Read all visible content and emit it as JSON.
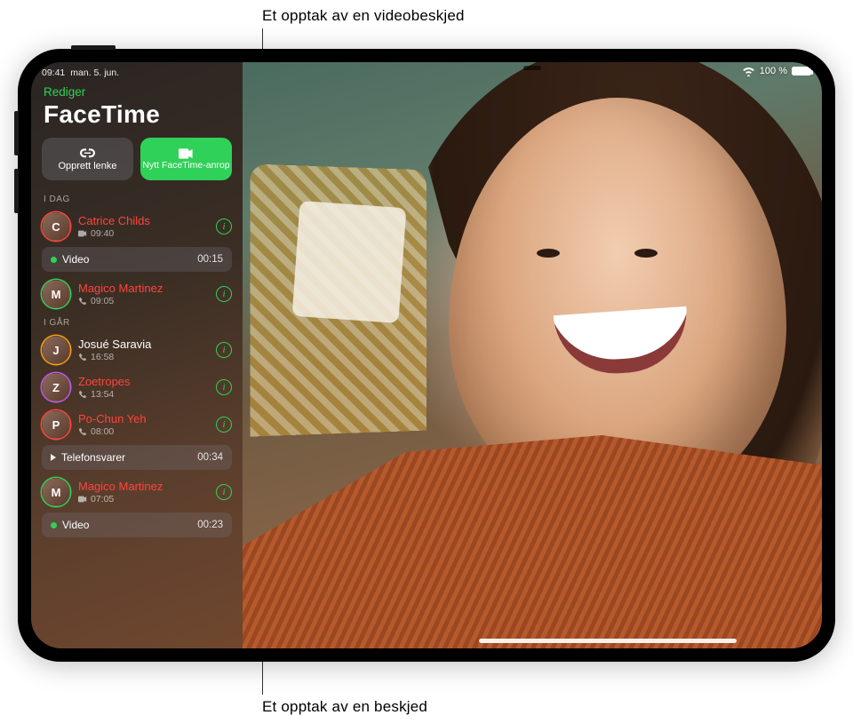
{
  "callouts": {
    "top": "Et opptak av en videobeskjed",
    "bottom": "Et opptak av en beskjed"
  },
  "status_bar": {
    "time": "09:41",
    "date": "man. 5. jun.",
    "battery_label": "100 %"
  },
  "sidebar": {
    "edit_label": "Rediger",
    "app_title": "FaceTime",
    "create_link_label": "Opprett lenke",
    "new_call_label": "Nytt FaceTime-anrop",
    "section_today": "I DAG",
    "section_yesterday": "I GÅR"
  },
  "calls": {
    "today": [
      {
        "name": "Catrice Childs",
        "time": "09:40",
        "type": "video",
        "missed": true,
        "initials": "C"
      },
      {
        "name": "Magico Martinez",
        "time": "09:05",
        "type": "audio",
        "missed": true,
        "initials": "M"
      }
    ],
    "yesterday": [
      {
        "name": "Josué Saravia",
        "time": "16:58",
        "type": "audio",
        "missed": false,
        "initials": "J"
      },
      {
        "name": "Zoetropes",
        "time": "13:54",
        "type": "audio",
        "missed": true,
        "initials": "Z"
      },
      {
        "name": "Po-Chun Yeh",
        "time": "08:00",
        "type": "audio",
        "missed": true,
        "initials": "P"
      },
      {
        "name": "Magico Martinez",
        "time": "07:05",
        "type": "video",
        "missed": true,
        "initials": "M"
      }
    ]
  },
  "messages": {
    "video_label": "Video",
    "video_duration": "00:15",
    "voicemail_label": "Telefonsvarer",
    "voicemail_duration": "00:34",
    "video2_label": "Video",
    "video2_duration": "00:23"
  }
}
